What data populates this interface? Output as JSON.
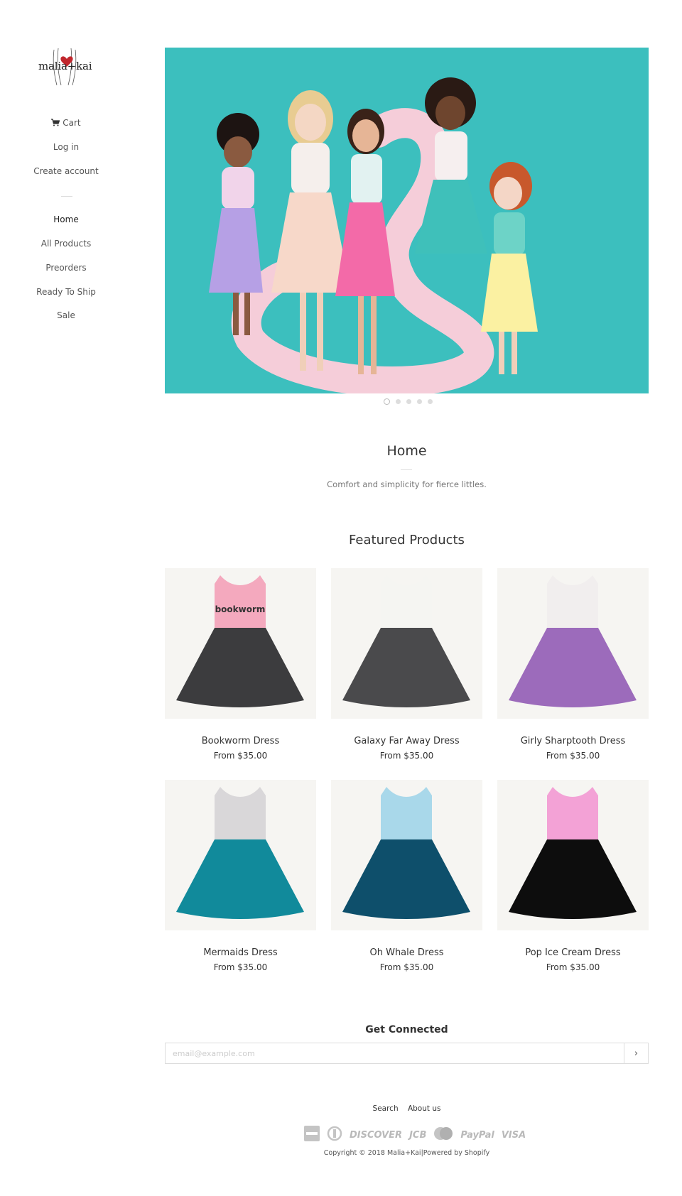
{
  "brand": {
    "logo_text": "malia+kai"
  },
  "sidebar": {
    "cart_label": "Cart",
    "login_label": "Log in",
    "create_account_label": "Create account",
    "nav": [
      {
        "label": "Home",
        "active": true
      },
      {
        "label": "All Products"
      },
      {
        "label": "Preorders"
      },
      {
        "label": "Ready To Ship"
      },
      {
        "label": "Sale"
      }
    ]
  },
  "slideshow": {
    "slide_count": 5,
    "active_index": 0
  },
  "intro": {
    "title": "Home",
    "subtitle": "Comfort and simplicity for fierce littles."
  },
  "featured": {
    "title": "Featured Products",
    "products": [
      {
        "title": "Bookworm Dress",
        "price": "From $35.00",
        "icon": "dress-bookworm-image",
        "top_color": "#f4a9be",
        "skirt_color": "#3c3c3e",
        "print_text": "bookworm"
      },
      {
        "title": "Galaxy Far Away Dress",
        "price": "From $35.00",
        "icon": "dress-galaxy-image",
        "top_color": "#f5f5f2",
        "skirt_color": "#4a4a4c"
      },
      {
        "title": "Girly Sharptooth Dress",
        "price": "From $35.00",
        "icon": "dress-sharptooth-image",
        "top_color": "#f1eeee",
        "skirt_color": "#9c6bbb"
      },
      {
        "title": "Mermaids Dress",
        "price": "From $35.00",
        "icon": "dress-mermaids-image",
        "top_color": "#d9d7d9",
        "skirt_color": "#118a9b"
      },
      {
        "title": "Oh Whale Dress",
        "price": "From $35.00",
        "icon": "dress-whale-image",
        "top_color": "#a9d8ea",
        "skirt_color": "#0e4f6b"
      },
      {
        "title": "Pop Ice Cream Dress",
        "price": "From $35.00",
        "icon": "dress-icecream-image",
        "top_color": "#f3a2d6",
        "skirt_color": "#0d0d0d"
      }
    ]
  },
  "newsletter": {
    "title": "Get Connected",
    "placeholder": "email@example.com",
    "submit_label": "›"
  },
  "footer": {
    "links": [
      "Search",
      "About us"
    ],
    "payments": [
      "AMEX",
      "DINERS",
      "DISCOVER",
      "JCB",
      "MASTER",
      "PayPal",
      "VISA"
    ],
    "copyright_prefix": "Copyright © 2018",
    "store_name": "Malia+Kai",
    "separator": "|",
    "powered_by": "Powered by Shopify"
  },
  "colors": {
    "hero_bg": "#3cbfbe",
    "accent": "#333333"
  }
}
